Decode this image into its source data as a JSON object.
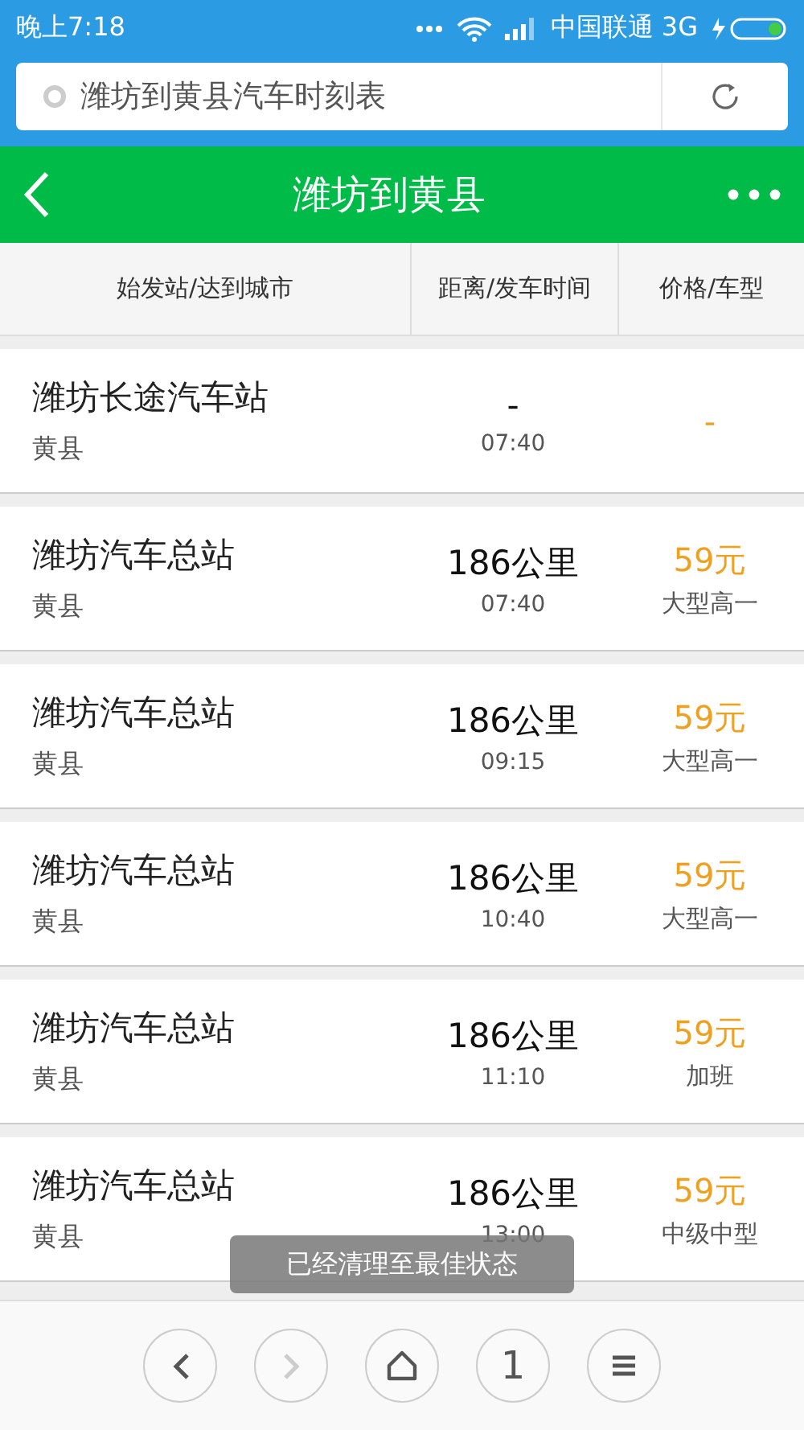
{
  "status_bar": {
    "time": "晚上7:18",
    "carrier": "中国联通 3G"
  },
  "search_bar": {
    "value": "潍坊到黄县汽车时刻表"
  },
  "header": {
    "title": "潍坊到黄县"
  },
  "table": {
    "columns": [
      "始发站/达到城市",
      "距离/发车时间",
      "价格/车型"
    ],
    "rows": [
      {
        "station": "潍坊长途汽车站",
        "city": "黄县",
        "distance": "-",
        "time": "07:40",
        "price": "-"
      },
      {
        "station": "潍坊汽车总站",
        "city": "黄县",
        "distance": "186公里",
        "time": "07:40",
        "price": "59元",
        "bus_type": "大型高一"
      },
      {
        "station": "潍坊汽车总站",
        "city": "黄县",
        "distance": "186公里",
        "time": "09:15",
        "price": "59元",
        "bus_type": "大型高一"
      },
      {
        "station": "潍坊汽车总站",
        "city": "黄县",
        "distance": "186公里",
        "time": "10:40",
        "price": "59元",
        "bus_type": "大型高一"
      },
      {
        "station": "潍坊汽车总站",
        "city": "黄县",
        "distance": "186公里",
        "time": "11:10",
        "price": "59元",
        "bus_type": "加班"
      },
      {
        "station": "潍坊汽车总站",
        "city": "黄县",
        "distance": "186公里",
        "time": "13:00",
        "price": "59元",
        "bus_type": "中级中型"
      }
    ]
  },
  "toast": {
    "text": "已经清理至最佳状态"
  },
  "bottom_nav": [
    {
      "kind": "back",
      "disabled": false
    },
    {
      "kind": "forward",
      "disabled": true
    },
    {
      "kind": "home",
      "disabled": false
    },
    {
      "kind": "tabs",
      "label": "1",
      "disabled": false
    },
    {
      "kind": "menu",
      "disabled": false
    }
  ]
}
